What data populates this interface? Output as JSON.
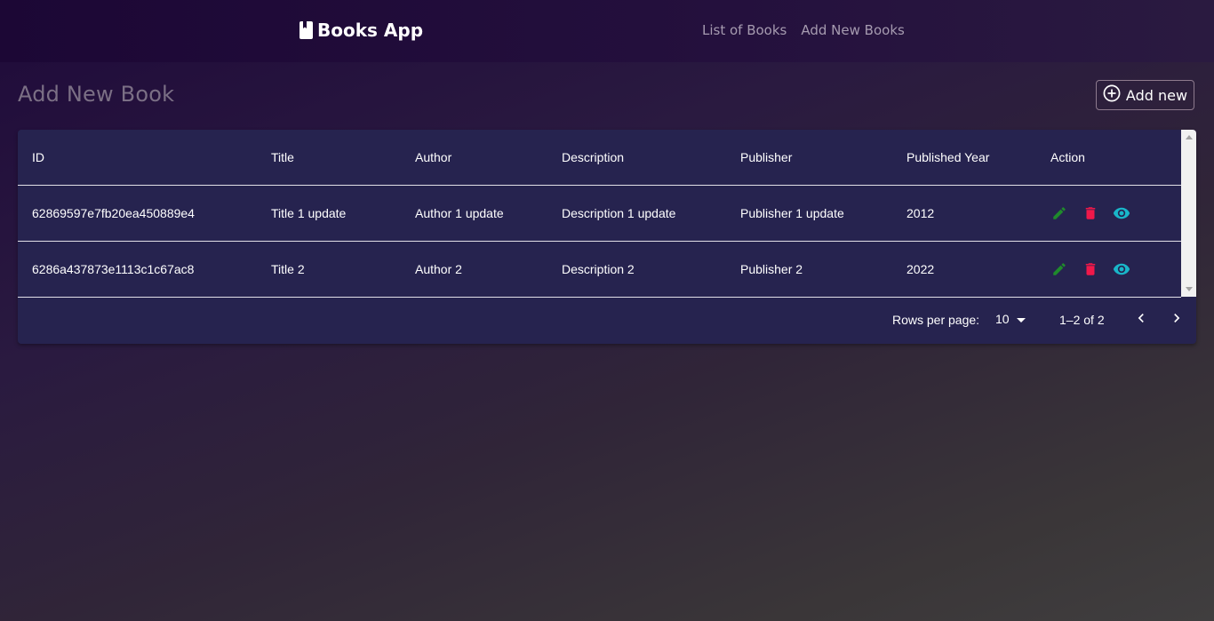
{
  "navbar": {
    "brand": "Books App",
    "links": [
      "List of Books",
      "Add New Books"
    ]
  },
  "page": {
    "title": "Add New Book",
    "add_button_label": "Add new"
  },
  "table": {
    "columns": [
      "ID",
      "Title",
      "Author",
      "Description",
      "Publisher",
      "Published Year",
      "Action"
    ],
    "rows": [
      {
        "id": "62869597e7fb20ea450889e4",
        "title": "Title 1 update",
        "author": "Author 1 update",
        "description": "Description 1 update",
        "publisher": "Publisher 1 update",
        "year": "2012"
      },
      {
        "id": "6286a437873e1113c1c67ac8",
        "title": "Title 2",
        "author": "Author 2",
        "description": "Description 2",
        "publisher": "Publisher 2",
        "year": "2022"
      }
    ],
    "action_icons": [
      "edit-icon",
      "delete-icon",
      "view-icon"
    ]
  },
  "pagination": {
    "rows_per_page_label": "Rows per page:",
    "rows_per_page_value": "10",
    "range": "1–2 of 2"
  },
  "colors": {
    "edit": "#1f8a2c",
    "delete": "#f0184a",
    "view": "#19b6c9",
    "table_bg": "#26234f"
  }
}
